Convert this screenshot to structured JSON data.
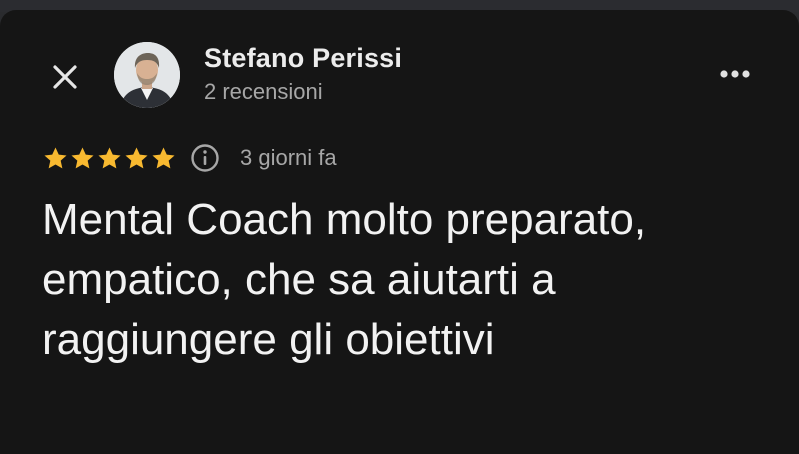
{
  "header": {
    "close_icon": "close-icon",
    "more_icon": "more-options-icon",
    "reviewer": {
      "name": "Stefano Perissi",
      "reviews_count": "2 recensioni",
      "avatar_icon": "avatar-photo"
    }
  },
  "review": {
    "rating": 5,
    "rating_max": 5,
    "star_color": "#f8b930",
    "info_icon": "info-icon",
    "date": "3 giorni fa",
    "text": "Mental Coach molto preparato, empatico, che sa aiutarti a raggiungere gli obiettivi"
  },
  "colors": {
    "background": "#151515",
    "text_primary": "#f2f2f2",
    "text_secondary": "#a7a7a7"
  }
}
